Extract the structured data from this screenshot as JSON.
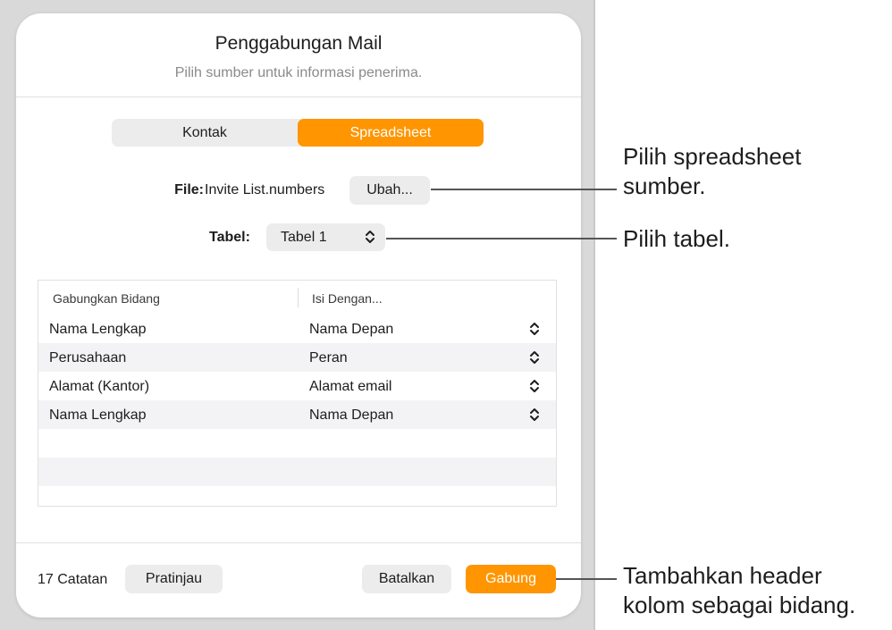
{
  "dialog": {
    "title": "Penggabungan Mail",
    "subtitle": "Pilih sumber untuk informasi penerima."
  },
  "source_tabs": [
    {
      "label": "Kontak",
      "selected": false
    },
    {
      "label": "Spreadsheet",
      "selected": true
    }
  ],
  "file": {
    "label": "File:",
    "name": "Invite List.numbers",
    "change_button": "Ubah..."
  },
  "table_select": {
    "label": "Tabel:",
    "value": "Tabel 1"
  },
  "merge_table": {
    "headers": [
      "Gabungkan Bidang",
      "Isi Dengan..."
    ],
    "rows": [
      {
        "field": "Nama Lengkap",
        "fill": "Nama Depan"
      },
      {
        "field": "Perusahaan",
        "fill": "Peran"
      },
      {
        "field": "Alamat (Kantor)",
        "fill": "Alamat email"
      },
      {
        "field": "Nama Lengkap",
        "fill": "Nama Depan"
      }
    ]
  },
  "footer": {
    "record_count": "17 Catatan",
    "preview_button": "Pratinjau",
    "cancel_button": "Batalkan",
    "merge_button": "Gabung"
  },
  "callouts": {
    "file_line1": "Pilih spreadsheet",
    "file_line2": "sumber.",
    "table": "Pilih tabel.",
    "merge_line1": "Tambahkan header",
    "merge_line2": "kolom sebagai bidang."
  },
  "colors": {
    "accent": "#ff9500",
    "button_bg": "#ececec",
    "backdrop": "#d9d9d9"
  }
}
